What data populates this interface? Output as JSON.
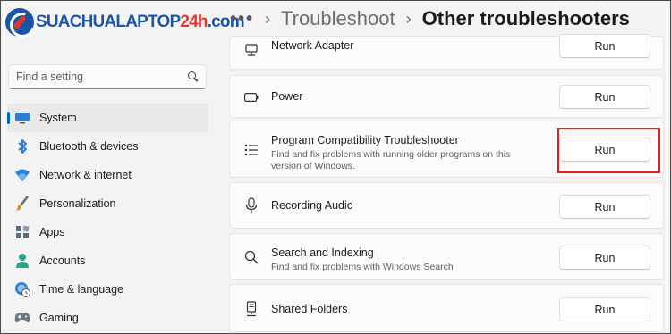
{
  "logo": {
    "part1": "SUACHUALAPTOP",
    "part2": "24h",
    "part3": ".com"
  },
  "header": {
    "more": "•••",
    "separator": "›",
    "parent": "Troubleshoot",
    "current": "Other troubleshooters"
  },
  "search": {
    "placeholder": "Find a setting"
  },
  "sidebar": {
    "items": [
      {
        "label": "System",
        "icon": "monitor-icon",
        "active": true
      },
      {
        "label": "Bluetooth & devices",
        "icon": "bluetooth-icon"
      },
      {
        "label": "Network & internet",
        "icon": "wifi-icon"
      },
      {
        "label": "Personalization",
        "icon": "brush-icon"
      },
      {
        "label": "Apps",
        "icon": "apps-icon"
      },
      {
        "label": "Accounts",
        "icon": "person-icon"
      },
      {
        "label": "Time & language",
        "icon": "globe-clock-icon"
      },
      {
        "label": "Gaming",
        "icon": "gamepad-icon"
      }
    ]
  },
  "troubleshooters": [
    {
      "title": "Network Adapter",
      "description": "",
      "button": "Run",
      "icon": "network-adapter-icon"
    },
    {
      "title": "Power",
      "description": "",
      "button": "Run",
      "icon": "battery-icon"
    },
    {
      "title": "Program Compatibility Troubleshooter",
      "description": "Find and fix problems with running older programs on this version of Windows.",
      "button": "Run",
      "icon": "list-icon",
      "highlighted": true
    },
    {
      "title": "Recording Audio",
      "description": "",
      "button": "Run",
      "icon": "microphone-icon"
    },
    {
      "title": "Search and Indexing",
      "description": "Find and fix problems with Windows Search",
      "button": "Run",
      "icon": "search-icon"
    },
    {
      "title": "Shared Folders",
      "description": "",
      "button": "Run",
      "icon": "shared-folder-icon"
    }
  ],
  "colors": {
    "accent": "#0067c0",
    "highlight": "#e02020",
    "brand_blue": "#1a56a8",
    "brand_red": "#e4352b"
  }
}
